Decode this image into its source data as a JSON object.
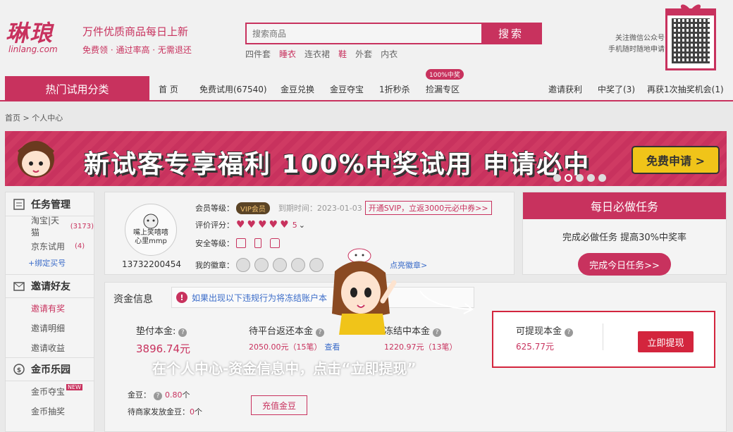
{
  "header": {
    "logo_text": "琳琅",
    "logo_domain": "linlang.com",
    "slogan_main": "万件优质商品每日上新",
    "slogan_sub": "免费领 · 通过率高 · 无需退还",
    "search_placeholder": "搜索商品",
    "search_button": "搜索",
    "hot_keywords": [
      "四件套",
      "睡衣",
      "连衣裙",
      "鞋",
      "外套",
      "内衣"
    ],
    "qr_line1": "关注微信公众号",
    "qr_line2": "手机随时随地申请"
  },
  "nav": {
    "category": "热门试用分类",
    "items": [
      "首 页",
      "免费试用(67540)",
      "金豆兑换",
      "金豆夺宝",
      "1折秒杀",
      "捡漏专区"
    ],
    "badge": "100%中奖",
    "right_items": [
      "邀请获利",
      "中奖了(3)",
      "再获1次抽奖机会(1)"
    ]
  },
  "breadcrumb": "首页 > 个人中心",
  "banner": {
    "text": "新试客专享福利 100%中奖试用 申请必中",
    "button": "免费申请 >"
  },
  "sidebar": {
    "sections": [
      {
        "title": "任务管理",
        "items": [
          {
            "label": "淘宝|天猫",
            "count": "(3173)"
          },
          {
            "label": "京东试用",
            "count": "(4)"
          }
        ],
        "link": "+绑定买号"
      },
      {
        "title": "邀请好友",
        "items": [
          {
            "label": "邀请有奖"
          },
          {
            "label": "邀请明细"
          },
          {
            "label": "邀请收益"
          }
        ]
      },
      {
        "title": "金币乐园",
        "items": [
          {
            "label": "金币夺宝",
            "tag": "NEW"
          },
          {
            "label": "金币抽奖"
          }
        ]
      }
    ]
  },
  "profile": {
    "avatar_text_1": "嘴上笑嘻嘻",
    "avatar_text_2": "心里mmp",
    "phone": "13732200454",
    "level_label": "会员等级：",
    "vip": "VIP会员",
    "expire": "到期时间：2023-01-03",
    "svip": "开通SVIP，立返3000元必中券>>",
    "rating_label": "评价评分：",
    "hearts": "♥♥♥♥♥",
    "rating_value": "5",
    "security_label": "安全等级：",
    "medals_label": "我的徽章：",
    "medals_link": "点亮徽章>"
  },
  "task": {
    "title": "每日必做任务",
    "desc": "完成必做任务 提高30%中奖率",
    "button": "完成今日任务>>"
  },
  "fund": {
    "title": "资金信息",
    "warning": "如果出现以下违规行为将冻结账户本",
    "columns": [
      {
        "label": "垫付本金:",
        "value": "3896.74元"
      },
      {
        "label": "待平台返还本金",
        "value": "2050.00元（15笔）",
        "link": "查看"
      },
      {
        "label": "冻结中本金",
        "value": "1220.97元（13笔）"
      }
    ],
    "coins_label": "金豆：",
    "coins_value": "0.80",
    "coins_unit": "个",
    "pending_label": "待商家发放金豆：",
    "pending_value": "0",
    "pending_unit": "个",
    "recharge": "充值金豆"
  },
  "withdraw": {
    "label": "可提现本金",
    "value": "625.77元",
    "button": "立即提现"
  },
  "caption": "在个人中心-资金信息中，点击“立即提现”"
}
